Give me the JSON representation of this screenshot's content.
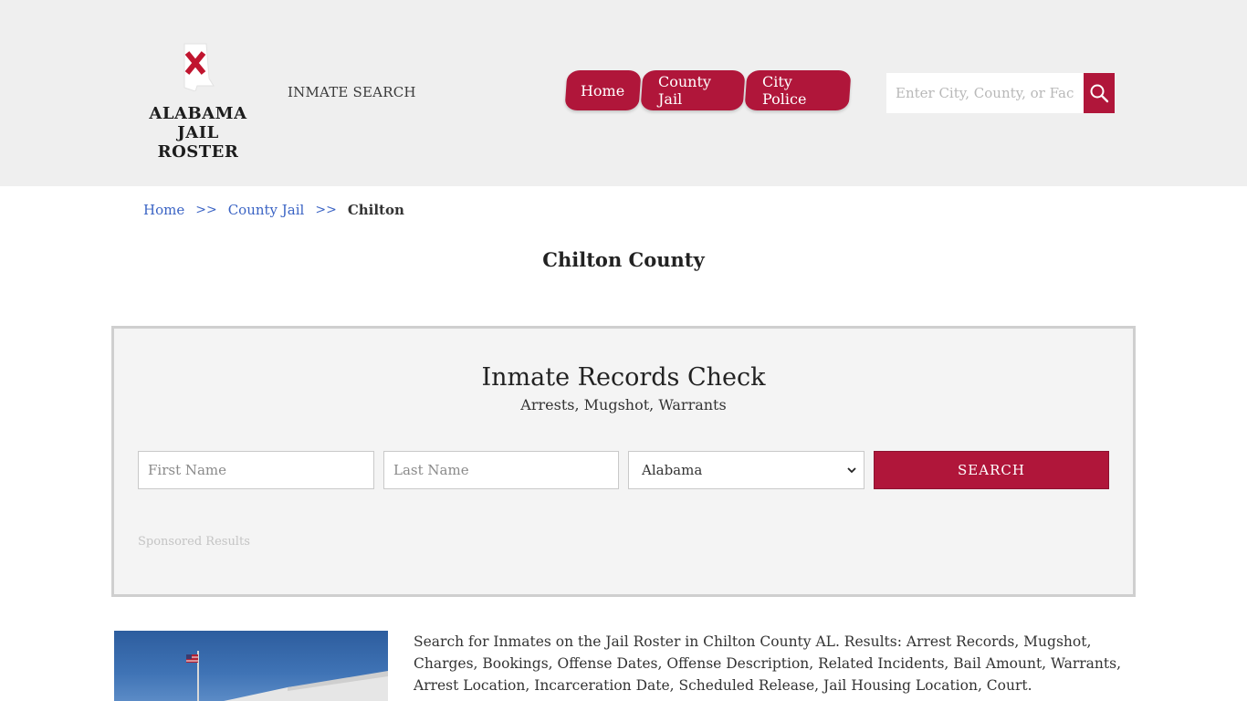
{
  "header": {
    "brand_line1": "ALABAMA",
    "brand_line2": "JAIL ROSTER",
    "inmate_search_link": "INMATE SEARCH",
    "nav": [
      {
        "label": "Home"
      },
      {
        "label": "County Jail"
      },
      {
        "label": "City Police"
      }
    ],
    "search": {
      "placeholder": "Enter City, County, or Facility",
      "icon": "search-icon"
    }
  },
  "breadcrumb": {
    "items": [
      "Home",
      "County Jail"
    ],
    "separator": ">>",
    "current": "Chilton"
  },
  "page_title": "Chilton County",
  "records_check": {
    "title": "Inmate Records Check",
    "subtitle": "Arrests, Mugshot, Warrants",
    "first_name_placeholder": "First Name",
    "last_name_placeholder": "Last Name",
    "state_selected": "Alabama",
    "search_button": "SEARCH",
    "sponsored": "Sponsored Results"
  },
  "description": "Search for Inmates on the Jail Roster in Chilton County AL. Results: Arrest Records, Mugshot, Charges, Bookings, Offense Dates, Offense Description, Related Incidents, Bail Amount, Warrants, Arrest Location, Incarceration Date, Scheduled Release, Jail Housing Location, Court.",
  "colors": {
    "accent": "#b0163a",
    "header_bg": "#efefef",
    "link": "#3a63c4",
    "box_bg": "#f4f4f4"
  }
}
